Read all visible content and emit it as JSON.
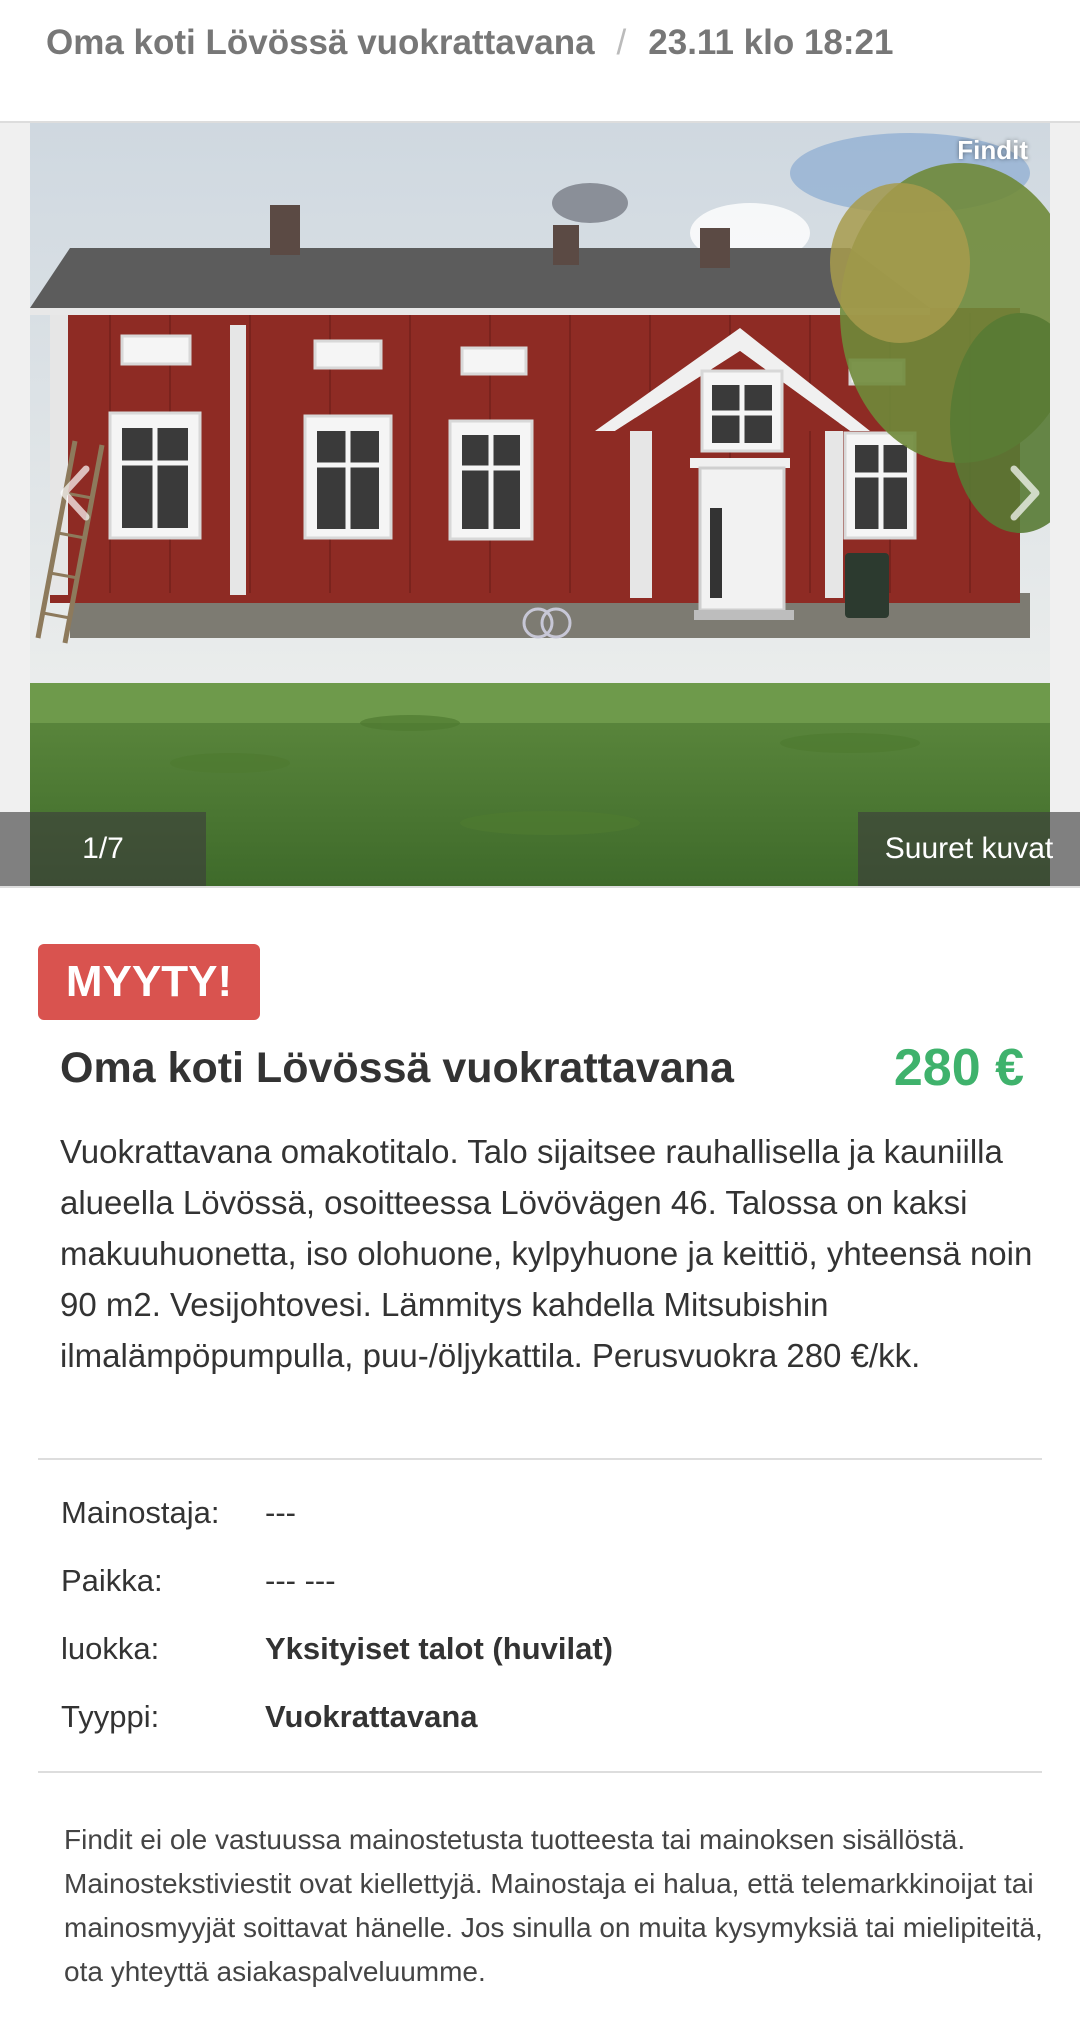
{
  "breadcrumb": {
    "title": "Oma koti Lövössä vuokrattavana",
    "separator": "/",
    "date": "23.11 klo 18:21"
  },
  "gallery": {
    "watermark": "Findit",
    "counter": "1/7",
    "big_images_label": "Suuret kuvat"
  },
  "ad": {
    "status_badge": "MYYTY!",
    "title": "Oma koti Lövössä vuokrattavana",
    "price": "280 €",
    "description": "Vuokrattavana omakotitalo. Talo sijaitsee rauhallisella ja kauniilla alueella Lövössä, osoitteessa Lövövägen 46. Talossa on kaksi makuuhuonetta, iso olohuone, kylpyhuone ja keittiö, yhteensä noin 90 m2. Vesijohtovesi. Lämmitys kahdella Mitsubishin ilmalämpöpumpulla, puu-/öljykattila. Perusvuokra 280 €/kk."
  },
  "details": [
    {
      "label": "Mainostaja:",
      "value": "---"
    },
    {
      "label": "Paikka:",
      "value": "--- ---"
    },
    {
      "label": "luokka:",
      "value": "Yksityiset talot (huvilat)"
    },
    {
      "label": "Tyyppi:",
      "value": "Vuokrattavana"
    }
  ],
  "disclaimer": "Findit ei ole vastuussa mainostetusta tuotteesta tai mainoksen sisällöstä. Mainostekstiviestit ovat kiellettyjä. Mainostaja ei halua, että telemarkkinoijat tai mainosmyyjät soittavat hänelle. Jos sinulla on muita kysymyksiä tai mielipiteitä, ota yhteyttä asiakaspalveluumme.",
  "colors": {
    "price": "#3fb26c",
    "sold_badge": "#d9534f",
    "house_red": "#8e2b24"
  }
}
